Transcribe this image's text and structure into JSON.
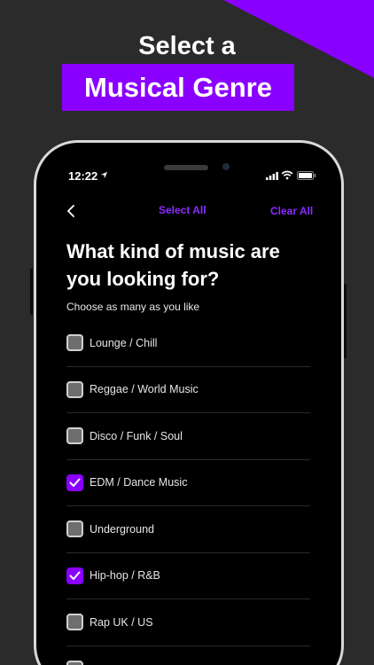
{
  "promo": {
    "line1": "Select a",
    "line2": "Musical Genre"
  },
  "status_bar": {
    "time": "12:22"
  },
  "nav": {
    "select_all_label": "Select All",
    "clear_all_label": "Clear All"
  },
  "question": {
    "title": "What kind of music are you looking for?",
    "subtitle": "Choose as many as you like"
  },
  "genres": [
    {
      "label": "Lounge / Chill",
      "checked": false
    },
    {
      "label": "Reggae / World Music",
      "checked": false
    },
    {
      "label": "Disco / Funk / Soul",
      "checked": false
    },
    {
      "label": "EDM / Dance Music",
      "checked": true
    },
    {
      "label": "Underground",
      "checked": false
    },
    {
      "label": "Hip-hop / R&B",
      "checked": true
    },
    {
      "label": "Rap UK / US",
      "checked": false
    }
  ],
  "colors": {
    "accent": "#8a00ff",
    "background": "#2b2b2b",
    "screen": "#000000"
  }
}
